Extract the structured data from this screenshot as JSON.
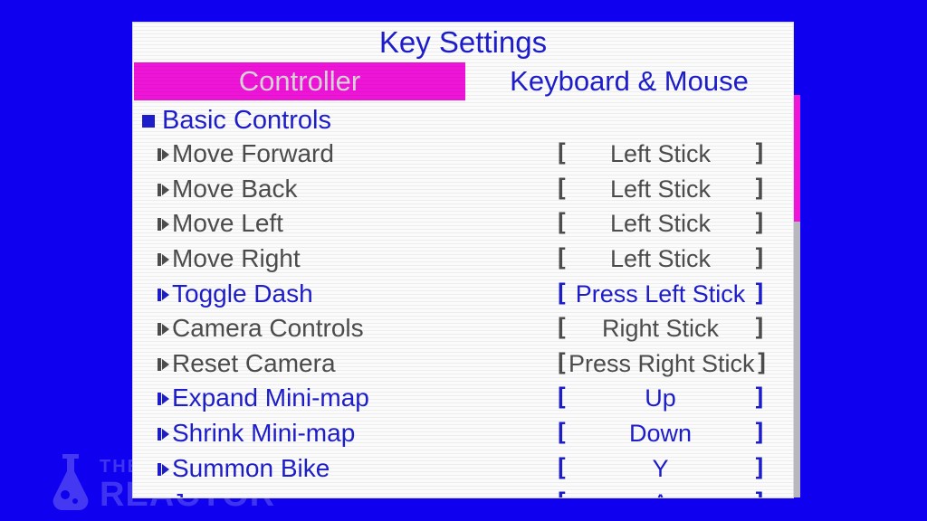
{
  "window": {
    "title": "Key Settings",
    "background_color": "#0f00ef",
    "panel_color": "#fbfbfc"
  },
  "tabs": [
    {
      "label": "Controller",
      "selected": true,
      "accent_color": "#ee15d8"
    },
    {
      "label": "Keyboard & Mouse",
      "selected": false,
      "accent_color": "#1d1dcc"
    }
  ],
  "group": {
    "label": "Basic Controls",
    "bullet_icon": "filled-square-icon"
  },
  "bindings": {
    "open_bracket": "[",
    "close_bracket": "]",
    "marker_icon": "play-triangle-icon",
    "rows": [
      {
        "action": "Move Forward",
        "binding": "Left Stick",
        "highlighted": false
      },
      {
        "action": "Move Back",
        "binding": "Left Stick",
        "highlighted": false
      },
      {
        "action": "Move Left",
        "binding": "Left Stick",
        "highlighted": false
      },
      {
        "action": "Move Right",
        "binding": "Left Stick",
        "highlighted": false
      },
      {
        "action": "Toggle Dash",
        "binding": "Press Left Stick",
        "highlighted": true
      },
      {
        "action": "Camera Controls",
        "binding": "Right Stick",
        "highlighted": false
      },
      {
        "action": "Reset Camera",
        "binding": "Press Right Stick",
        "highlighted": false
      },
      {
        "action": "Expand Mini-map",
        "binding": "Up",
        "highlighted": true
      },
      {
        "action": "Shrink Mini-map",
        "binding": "Down",
        "highlighted": true
      },
      {
        "action": "Summon Bike",
        "binding": "Y",
        "highlighted": true
      },
      {
        "action": "Jump",
        "binding": "A",
        "highlighted": true
      }
    ]
  },
  "scrollbar": {
    "thumb_color": "#ee15d8",
    "track_color": "#b7b7bd"
  },
  "watermark": {
    "line1": "THE MA",
    "line2": "REACTOR",
    "flask_icon": "flask-icon"
  }
}
